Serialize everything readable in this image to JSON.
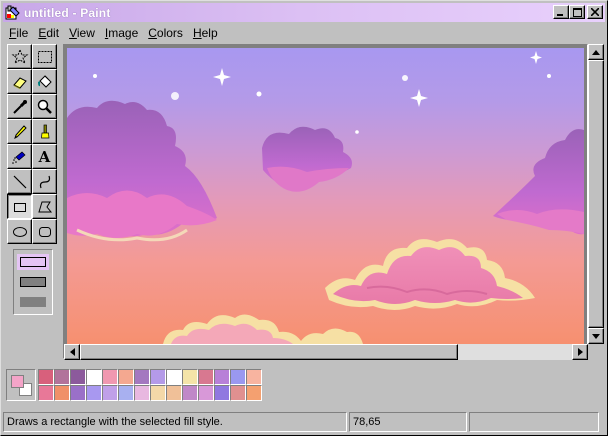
{
  "window": {
    "title": "untitled - Paint",
    "buttons": [
      "minimize",
      "maximize",
      "close"
    ],
    "titlebar_color": "#d8b8f0"
  },
  "menu": [
    {
      "label": "File",
      "accel": "F",
      "rest": "ile"
    },
    {
      "label": "Edit",
      "accel": "E",
      "rest": "dit"
    },
    {
      "label": "View",
      "accel": "V",
      "rest": "iew"
    },
    {
      "label": "Image",
      "accel": "I",
      "rest": "mage"
    },
    {
      "label": "Colors",
      "accel": "C",
      "rest": "olors"
    },
    {
      "label": "Help",
      "accel": "H",
      "rest": "elp"
    }
  ],
  "tools": [
    {
      "name": "free-form-select",
      "icon": "star-select-icon"
    },
    {
      "name": "select",
      "icon": "rect-select-icon"
    },
    {
      "name": "eraser",
      "icon": "eraser-icon"
    },
    {
      "name": "fill-with-color",
      "icon": "paint-bucket-icon"
    },
    {
      "name": "pick-color",
      "icon": "eyedropper-icon"
    },
    {
      "name": "magnifier",
      "icon": "magnifier-icon"
    },
    {
      "name": "pencil",
      "icon": "pencil-icon"
    },
    {
      "name": "brush",
      "icon": "brush-icon"
    },
    {
      "name": "airbrush",
      "icon": "airbrush-icon"
    },
    {
      "name": "text",
      "icon": "text-icon",
      "glyph": "A"
    },
    {
      "name": "line",
      "icon": "line-icon"
    },
    {
      "name": "curve",
      "icon": "curve-icon"
    },
    {
      "name": "rectangle",
      "icon": "rectangle-icon",
      "selected": true
    },
    {
      "name": "polygon",
      "icon": "polygon-icon"
    },
    {
      "name": "ellipse",
      "icon": "ellipse-icon"
    },
    {
      "name": "rounded-rectangle",
      "icon": "rounded-rect-icon"
    }
  ],
  "fill_styles": [
    "outline",
    "outline-fill",
    "fill"
  ],
  "selected_fill_style": "outline",
  "colors": {
    "foreground": "#f4a4c8",
    "background": "#ffffff",
    "palette_row1": [
      "#d8607c",
      "#b2739b",
      "#8c5a9c",
      "#ffffff",
      "#f098b0",
      "#f4a890",
      "#a478c0",
      "#b49ae8",
      "#ffffff",
      "#f4e4a8",
      "#d87890",
      "#b880d8",
      "#9a98f0",
      "#f8b4a0"
    ],
    "palette_row2": [
      "#e87898",
      "#f09068",
      "#9a70c8",
      "#a898f0",
      "#c0a0e8",
      "#a8b0f0",
      "#e8b8e0",
      "#f4d8a8",
      "#f0c098",
      "#c088c8",
      "#d898d8",
      "#9078e0",
      "#e09090",
      "#f4a070"
    ]
  },
  "canvas": {
    "sky_top": "#a898f0",
    "sky_bottom": "#f69070"
  },
  "status": {
    "message": "Draws a rectangle with the selected fill style.",
    "coordinates": "78,65",
    "size": ""
  }
}
